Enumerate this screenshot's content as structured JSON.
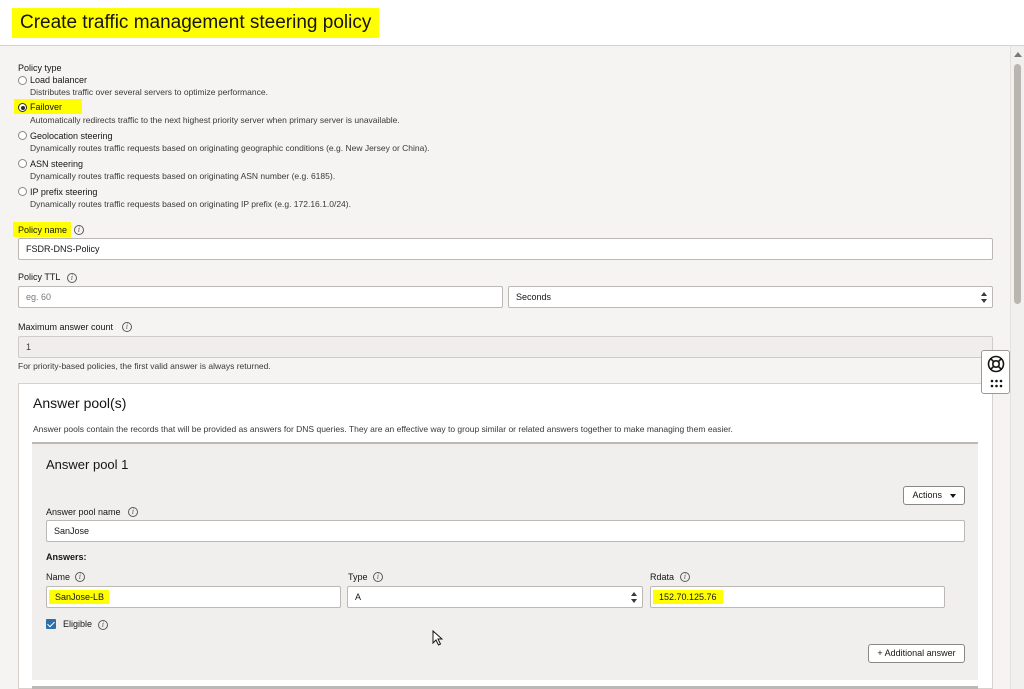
{
  "header": {
    "title": "Create traffic management steering policy"
  },
  "policy_type": {
    "label": "Policy type",
    "options": [
      {
        "title": "Load balancer",
        "desc": "Distributes traffic over several servers to optimize performance.",
        "checked": false
      },
      {
        "title": "Failover",
        "desc": "Automatically redirects traffic to the next highest priority server when primary server is unavailable.",
        "checked": true
      },
      {
        "title": "Geolocation steering",
        "desc": "Dynamically routes traffic requests based on originating geographic conditions (e.g. New Jersey or China).",
        "checked": false
      },
      {
        "title": "ASN steering",
        "desc": "Dynamically routes traffic requests based on originating ASN number (e.g. 6185).",
        "checked": false
      },
      {
        "title": "IP prefix steering",
        "desc": "Dynamically routes traffic requests based on originating IP prefix (e.g. 172.16.1.0/24).",
        "checked": false
      }
    ]
  },
  "policy_name": {
    "label": "Policy name",
    "value": "FSDR-DNS-Policy"
  },
  "policy_ttl": {
    "label": "Policy TTL",
    "placeholder": "eg. 60",
    "unit": "Seconds"
  },
  "max_answer": {
    "label": "Maximum answer count",
    "value": "1",
    "hint": "For priority-based policies, the first valid answer is always returned."
  },
  "answer_pools": {
    "title": "Answer pool(s)",
    "desc": "Answer pools contain the records that will be provided as answers for DNS queries. They are an effective way to group similar or related answers together to make managing them easier.",
    "pool": {
      "title": "Answer pool 1",
      "actions_label": "Actions",
      "name_label": "Answer pool name",
      "name_value": "SanJose",
      "answers_label": "Answers:",
      "col_name": "Name",
      "col_type": "Type",
      "col_rdata": "Rdata",
      "answer": {
        "name": "SanJose-LB",
        "type": "A",
        "rdata": "152.70.125.76"
      },
      "eligible_label": "Eligible",
      "add_answer_label": "+ Additional answer"
    }
  },
  "icons": [
    "info-icon",
    "lifebuoy-icon",
    "apps-grid-icon",
    "caret-down-icon",
    "check-icon"
  ],
  "colors": {
    "highlight": "#ffff00",
    "checkbox": "#2f6fa8"
  }
}
